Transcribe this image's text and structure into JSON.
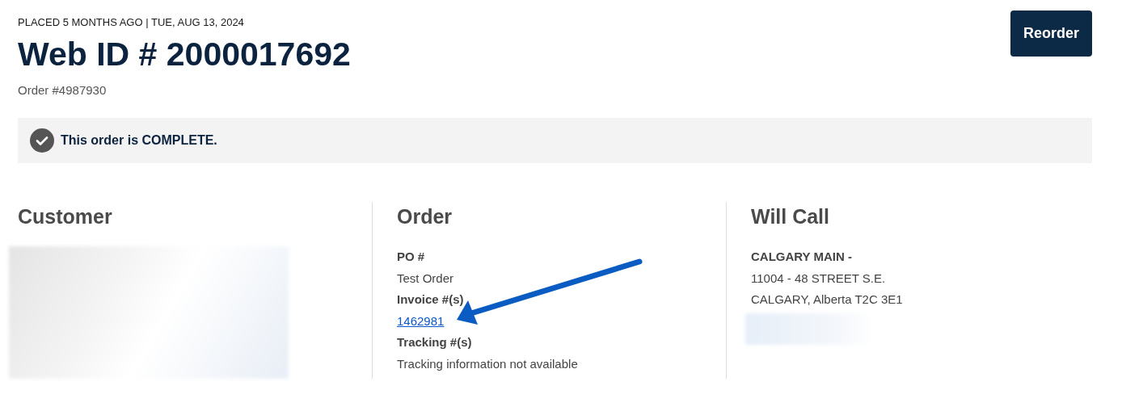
{
  "header": {
    "meta": "PLACED 5 MONTHS AGO | TUE, AUG 13, 2024",
    "title": "Web ID # 2000017692",
    "order_number": "Order #4987930",
    "reorder_button": "Reorder"
  },
  "status": {
    "message": "This order is COMPLETE.",
    "complete": true
  },
  "sections": [
    {
      "kind": "customer",
      "heading": "Customer",
      "redacted": true
    },
    {
      "kind": "order",
      "heading": "Order",
      "fields": [
        {
          "label": "PO #",
          "value": "Test Order",
          "link": false,
          "annotated": false
        },
        {
          "label": "Invoice #(s)",
          "value": "1462981",
          "link": true,
          "annotated": true
        },
        {
          "label": "Tracking #(s)",
          "value": "Tracking information not available",
          "link": false,
          "annotated": false
        }
      ]
    },
    {
      "kind": "will_call",
      "heading": "Will Call",
      "name": "CALGARY MAIN -",
      "lines": [
        "11004 - 48 STREET S.E.",
        "CALGARY, Alberta T2C 3E1"
      ],
      "redacted": true
    }
  ]
}
